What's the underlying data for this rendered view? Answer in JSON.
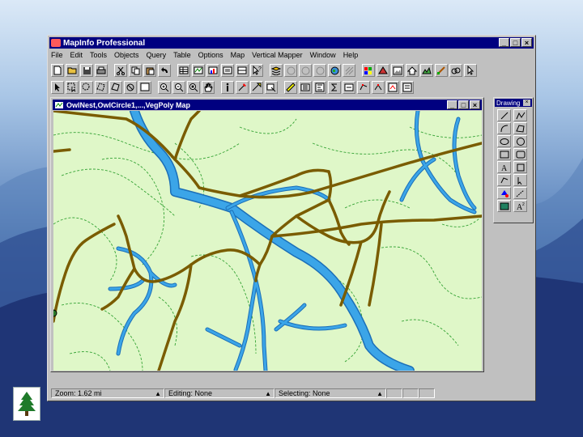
{
  "app": {
    "title": "MapInfo Professional",
    "window_buttons": [
      "_",
      "□",
      "×"
    ]
  },
  "menu": [
    "File",
    "Edit",
    "Tools",
    "Objects",
    "Query",
    "Table",
    "Options",
    "Map",
    "Vertical Mapper",
    "Window",
    "Help"
  ],
  "map_window": {
    "title": "OwlNest,OwlCircle1,...,VegPoly Map",
    "buttons": [
      "_",
      "□",
      "×"
    ]
  },
  "drawing_palette": {
    "title": "Drawing",
    "close": "×"
  },
  "status": {
    "zoom": "Zoom: 1.62 mi",
    "editing": "Editing: None",
    "selecting": "Selecting: None"
  },
  "colors": {
    "titlebar": "#000080",
    "map_background": "#dff7c8",
    "roads": "#7a5c00",
    "rivers": "#3ba5e8",
    "contours": "#35a335"
  }
}
